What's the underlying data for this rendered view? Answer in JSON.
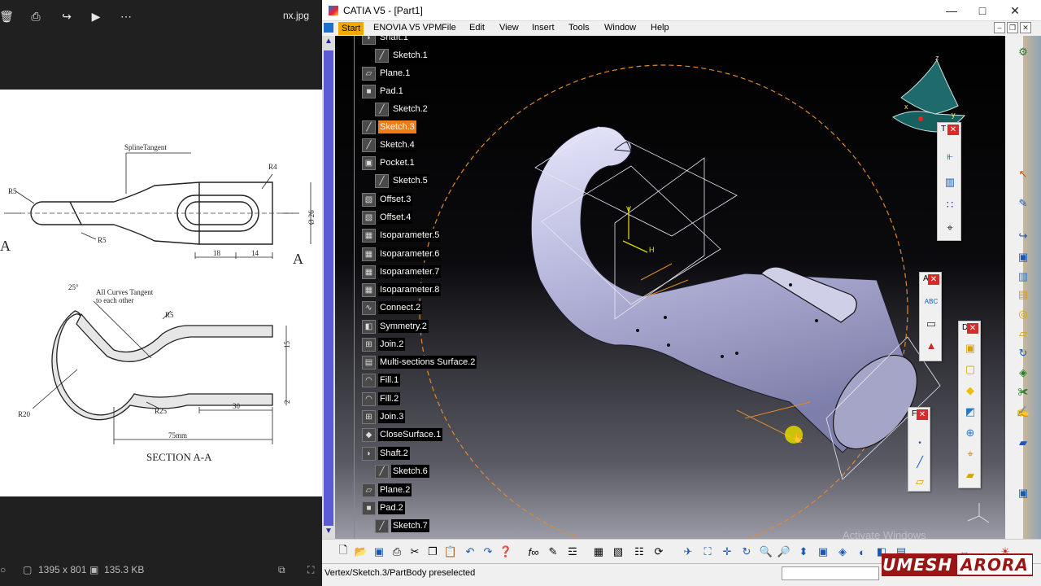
{
  "viewer": {
    "file_name": "nx.jpg",
    "dimensions": "1395 x 801",
    "file_size": "135.3 KB",
    "drawing": {
      "top_labels": [
        "SplineTangent",
        "R4",
        "R5",
        "R5",
        "Ø 26",
        "18",
        "14",
        "A",
        "A"
      ],
      "section_labels": [
        "25°",
        "All Curves Tangent",
        "to each other",
        "R5",
        "15",
        "R20",
        "R25",
        "30",
        "2",
        "75mm"
      ],
      "section_title": "SECTION A-A"
    }
  },
  "catia": {
    "title": "CATIA V5 - [Part1]",
    "menu": [
      "Start",
      "ENOVIA V5 VPM",
      "File",
      "Edit",
      "View",
      "Insert",
      "Tools",
      "Window",
      "Help"
    ],
    "tree": [
      {
        "label": "Shaft.1",
        "icon": "shaft-icon"
      },
      {
        "label": "Sketch.1",
        "icon": "sketch-icon"
      },
      {
        "label": "Plane.1",
        "icon": "plane-icon"
      },
      {
        "label": "Pad.1",
        "icon": "pad-icon"
      },
      {
        "label": "Sketch.2",
        "icon": "sketch-icon"
      },
      {
        "label": "Sketch.3",
        "icon": "sketch-icon",
        "selected": true
      },
      {
        "label": "Sketch.4",
        "icon": "sketch-icon"
      },
      {
        "label": "Pocket.1",
        "icon": "pocket-icon"
      },
      {
        "label": "Sketch.5",
        "icon": "sketch-icon"
      },
      {
        "label": "Offset.3",
        "icon": "offset-icon"
      },
      {
        "label": "Offset.4",
        "icon": "offset-icon"
      },
      {
        "label": "Isoparameter.5",
        "icon": "isoparameter-icon"
      },
      {
        "label": "Isoparameter.6",
        "icon": "isoparameter-icon"
      },
      {
        "label": "Isoparameter.7",
        "icon": "isoparameter-icon"
      },
      {
        "label": "Isoparameter.8",
        "icon": "isoparameter-icon"
      },
      {
        "label": "Connect.2",
        "icon": "connect-icon"
      },
      {
        "label": "Symmetry.2",
        "icon": "symmetry-icon"
      },
      {
        "label": "Join.2",
        "icon": "join-icon"
      },
      {
        "label": "Multi-sections Surface.2",
        "icon": "multisection-icon"
      },
      {
        "label": "Fill.1",
        "icon": "fill-icon"
      },
      {
        "label": "Fill.2",
        "icon": "fill-icon"
      },
      {
        "label": "Join.3",
        "icon": "join-icon"
      },
      {
        "label": "CloseSurface.1",
        "icon": "closesurface-icon"
      },
      {
        "label": "Shaft.2",
        "icon": "shaft-icon"
      },
      {
        "label": "Sketch.6",
        "icon": "sketch-icon"
      },
      {
        "label": "Plane.2",
        "icon": "plane-icon"
      },
      {
        "label": "Pad.2",
        "icon": "pad-icon"
      },
      {
        "label": "Sketch.7",
        "icon": "sketch-icon"
      }
    ],
    "axis_labels": {
      "v": "V",
      "h": "H",
      "z": "z",
      "x": "x",
      "y": "y"
    },
    "floating_toolbars": [
      {
        "title": "T",
        "buttons": [
          "constraint-icon",
          "constraint-defined-icon",
          "multi-constraint-icon",
          "snap-icon"
        ]
      },
      {
        "title": "A",
        "buttons": [
          "text-icon",
          "balloon-icon",
          "datum-icon"
        ]
      },
      {
        "title": "D",
        "buttons": [
          "pad-tool-icon",
          "pocket-tool-icon",
          "shaft-tool-icon",
          "groove-tool-icon",
          "hole-tool-icon",
          "rib-tool-icon",
          "slot-tool-icon"
        ]
      },
      {
        "title": "F",
        "buttons": [
          "point-icon",
          "line-icon",
          "plane-tool-icon"
        ]
      }
    ],
    "status_text": "Vertex/Sketch.3/PartBody preselected",
    "activate_text": "Activate Windows",
    "watermark": [
      "UMESH",
      "ARORA"
    ]
  }
}
